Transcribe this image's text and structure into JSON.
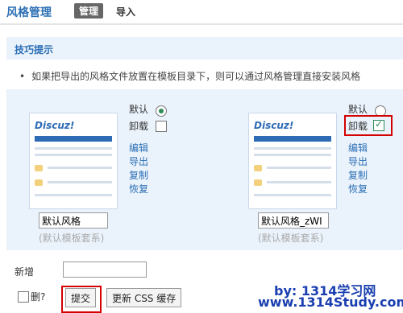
{
  "header": {
    "title": "风格管理",
    "tab_active": "管理",
    "tab_import": "导入"
  },
  "tips": {
    "title": "技巧提示",
    "bullet": "•",
    "text": "如果把导出的风格文件放置在模板目录下，则可以通过风格管理直接安装风格"
  },
  "themes": [
    {
      "name": "默认风格",
      "sub": "(默认模板套系)",
      "default_label": "默认",
      "uninstall_label": "卸载",
      "actions": [
        "编辑",
        "导出",
        "复制",
        "恢复"
      ],
      "default_selected": true,
      "uninstall_checked": false,
      "logo_text": "Discuz!"
    },
    {
      "name": "默认风格_zWI",
      "sub": "(默认模板套系)",
      "default_label": "默认",
      "uninstall_label": "卸载",
      "actions": [
        "编辑",
        "导出",
        "复制",
        "恢复"
      ],
      "default_selected": false,
      "uninstall_checked": true,
      "logo_text": "Discuz!"
    }
  ],
  "footer": {
    "add_label": "新增",
    "add_value": "",
    "delete_label": "删?",
    "submit_label": "提交",
    "refresh_label": "更新 CSS 缓存"
  },
  "watermark": {
    "line1": "by: 1314学习网",
    "line2": "www.1314Study.com"
  },
  "colors": {
    "accent": "#2b6fb5",
    "panel_bg": "#eaf2fb",
    "highlight": "#d40000",
    "check": "#2e8b57"
  }
}
